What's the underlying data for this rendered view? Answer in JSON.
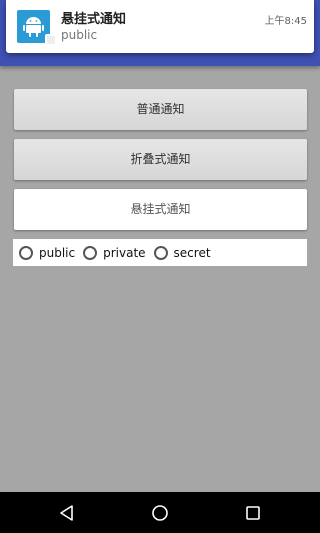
{
  "notification": {
    "title": "悬挂式通知",
    "text": "public",
    "time": "上午8:45",
    "icon": "android-icon",
    "icon_color": "#2b9bd6"
  },
  "app": {
    "appbar_color": "#3f51b5",
    "background_color": "#a6a6a6"
  },
  "buttons": [
    {
      "label": "普通通知"
    },
    {
      "label": "折叠式通知"
    },
    {
      "label": "悬挂式通知"
    }
  ],
  "visibility": {
    "options": [
      {
        "label": "public",
        "checked": false
      },
      {
        "label": "private",
        "checked": false
      },
      {
        "label": "secret",
        "checked": false
      }
    ]
  },
  "navbar": {
    "items": [
      "back-icon",
      "home-icon",
      "recents-icon"
    ]
  }
}
